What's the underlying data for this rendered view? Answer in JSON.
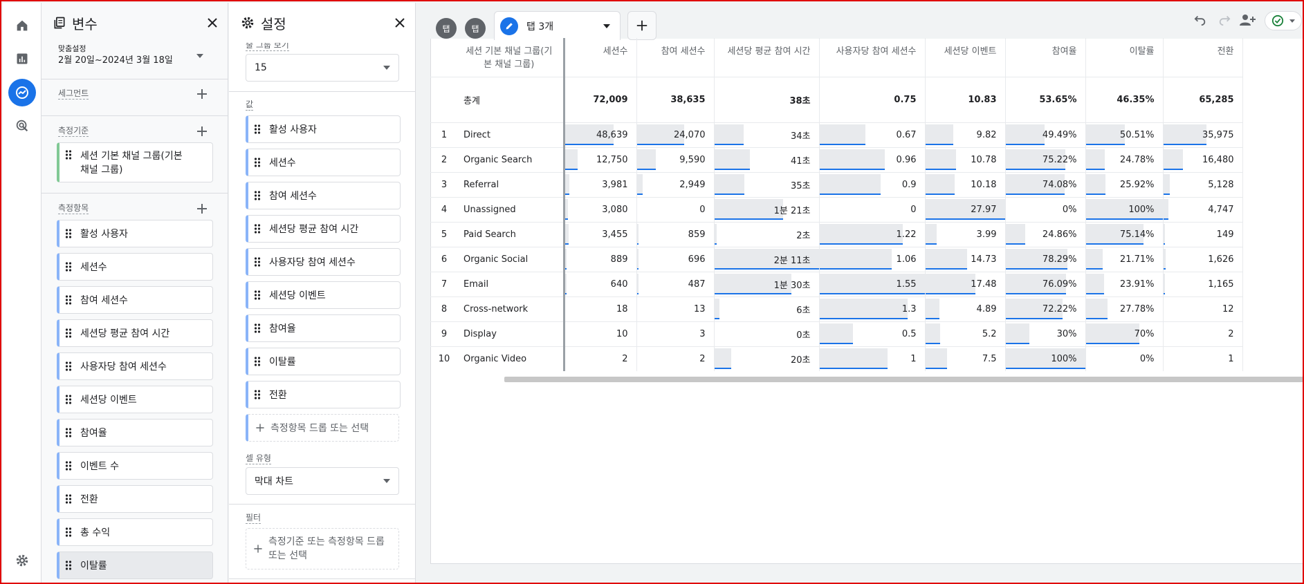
{
  "variables": {
    "title": "변수",
    "date_label": "맞춤설정",
    "date_range": "2월 20일~2024년 3월 18일",
    "segments_label": "세그먼트",
    "dimensions_label": "측정기준",
    "dimension_item": "세션 기본 채널 그룹(기본 채널 그룹)",
    "metrics_label": "측정항목",
    "metrics": [
      "활성 사용자",
      "세션수",
      "참여 세션수",
      "세션당 평균 참여 시간",
      "사용자당 참여 세션수",
      "세션당 이벤트",
      "참여율",
      "이벤트 수",
      "전환",
      "총 수익",
      "이탈률"
    ]
  },
  "settings": {
    "title": "설정",
    "rows_label": "줄 그룹 보기",
    "rows_value": "15",
    "values_label": "값",
    "values": [
      "활성 사용자",
      "세션수",
      "참여 세션수",
      "세션당 평균 참여 시간",
      "사용자당 참여 세션수",
      "세션당 이벤트",
      "참여율",
      "이탈률",
      "전환"
    ],
    "drop_metric": "측정항목 드롭 또는 선택",
    "cell_type_label": "셀 유형",
    "cell_type_value": "막대 차트",
    "filter_label": "필터",
    "drop_filter": "측정기준 또는 측정항목 드롭 또는 선택"
  },
  "tabs": {
    "tab1": "탭",
    "tab2": "탭",
    "tab3": "탭 3개"
  },
  "table": {
    "headers": [
      "세션 기본 채널 그룹(기본 채널 그룹)",
      "세션수",
      "참여 세션수",
      "세션당 평균 참여 시간",
      "사용자당 참여 세션수",
      "세션당 이벤트",
      "참여율",
      "이탈률",
      "전환"
    ],
    "total_label": "총계",
    "totals": [
      "72,009",
      "38,635",
      "38초",
      "0.75",
      "10.83",
      "53.65%",
      "46.35%",
      "65,285"
    ],
    "rows": [
      {
        "rank": "1",
        "name": "Direct",
        "cells": [
          "48,639",
          "24,070",
          "34초",
          "0.67",
          "9.82",
          "49.49%",
          "50.51%",
          "35,975"
        ],
        "fill": [
          0.676,
          0.623,
          0.279,
          0.435,
          0.354,
          0.493,
          0.505,
          0.551
        ]
      },
      {
        "rank": "2",
        "name": "Organic Search",
        "cells": [
          "12,750",
          "9,590",
          "41초",
          "0.96",
          "10.78",
          "75.22%",
          "24.78%",
          "16,480"
        ],
        "fill": [
          0.177,
          0.248,
          0.336,
          0.623,
          0.389,
          0.75,
          0.248,
          0.252
        ]
      },
      {
        "rank": "3",
        "name": "Referral",
        "cells": [
          "3,981",
          "2,949",
          "35초",
          "0.9",
          "10.18",
          "74.08%",
          "25.92%",
          "5,128"
        ],
        "fill": [
          0.055,
          0.076,
          0.287,
          0.584,
          0.367,
          0.739,
          0.259,
          0.079
        ]
      },
      {
        "rank": "4",
        "name": "Unassigned",
        "cells": [
          "3,080",
          "0",
          "1분 21초",
          "0",
          "27.97",
          "0%",
          "100%",
          "4,747"
        ],
        "fill": [
          0.043,
          0,
          0.664,
          0,
          1.0,
          0,
          1.0,
          0.073
        ]
      },
      {
        "rank": "5",
        "name": "Paid Search",
        "cells": [
          "3,455",
          "859",
          "2초",
          "1.22",
          "3.99",
          "24.86%",
          "75.14%",
          "149"
        ],
        "fill": [
          0.048,
          0.022,
          0.016,
          0.792,
          0.143,
          0.248,
          0.751,
          0.002
        ]
      },
      {
        "rank": "6",
        "name": "Organic Social",
        "cells": [
          "889",
          "696",
          "2분 11초",
          "1.06",
          "14.73",
          "78.29%",
          "21.71%",
          "1,626"
        ],
        "fill": [
          0.012,
          0.018,
          1.0,
          0.688,
          0.527,
          0.781,
          0.217,
          0.025
        ]
      },
      {
        "rank": "7",
        "name": "Email",
        "cells": [
          "640",
          "487",
          "1분 30초",
          "1.55",
          "17.48",
          "76.09%",
          "23.91%",
          "1,165"
        ],
        "fill": [
          0.009,
          0.013,
          0.738,
          1.0,
          0.625,
          0.759,
          0.239,
          0.018
        ]
      },
      {
        "rank": "8",
        "name": "Cross-network",
        "cells": [
          "18",
          "13",
          "6초",
          "1.3",
          "4.89",
          "72.22%",
          "27.78%",
          "12"
        ],
        "fill": [
          0,
          0,
          0.049,
          0.843,
          0.175,
          0.72,
          0.278,
          0
        ]
      },
      {
        "rank": "9",
        "name": "Display",
        "cells": [
          "10",
          "3",
          "0초",
          "0.5",
          "5.2",
          "30%",
          "70%",
          "2"
        ],
        "fill": [
          0,
          0,
          0,
          0.324,
          0.186,
          0.3,
          0.7,
          0
        ]
      },
      {
        "rank": "10",
        "name": "Organic Video",
        "cells": [
          "2",
          "2",
          "20초",
          "1",
          "7.5",
          "100%",
          "0%",
          "1"
        ],
        "fill": [
          0,
          0,
          0.164,
          0.648,
          0.268,
          1.0,
          0,
          0
        ]
      }
    ]
  },
  "colors": {
    "accent": "#1a73e8",
    "bar_fill": "#e8eaed",
    "border": "#dadce0"
  }
}
